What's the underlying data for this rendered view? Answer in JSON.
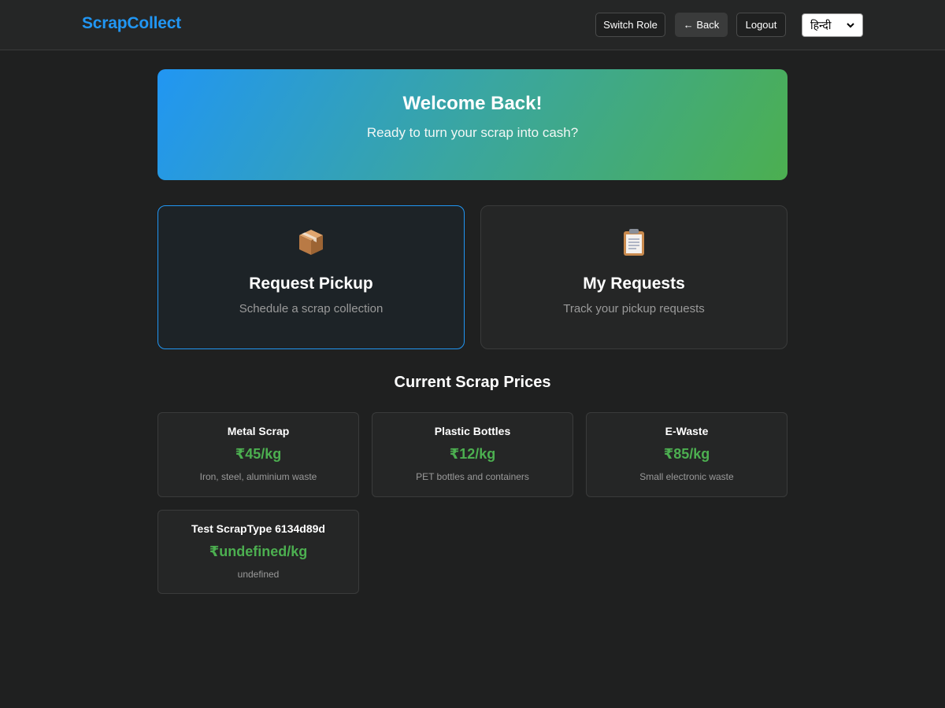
{
  "header": {
    "brand": "ScrapCollect",
    "switch_role_label": "Switch Role",
    "back_label": "← Back",
    "logout_label": "Logout",
    "language_selected": "हिन्दी"
  },
  "hero": {
    "title": "Welcome Back!",
    "subtitle": "Ready to turn your scrap into cash?"
  },
  "actions": [
    {
      "title": "Request Pickup",
      "description": "Schedule a scrap collection",
      "icon": "package-icon"
    },
    {
      "title": "My Requests",
      "description": "Track your pickup requests",
      "icon": "clipboard-icon"
    }
  ],
  "prices": {
    "section_title": "Current Scrap Prices",
    "items": [
      {
        "name": "Metal Scrap",
        "price": "₹45/kg",
        "description": "Iron, steel, aluminium waste"
      },
      {
        "name": "Plastic Bottles",
        "price": "₹12/kg",
        "description": "PET bottles and containers"
      },
      {
        "name": "E-Waste",
        "price": "₹85/kg",
        "description": "Small electronic waste"
      },
      {
        "name": "Test ScrapType 6134d89d",
        "price": "₹undefined/kg",
        "description": "undefined"
      }
    ]
  },
  "colors": {
    "brand": "#2196f3",
    "price": "#4caf50",
    "background": "#1f2020",
    "hero_gradient_start": "#2196f3",
    "hero_gradient_end": "#4caf50"
  }
}
